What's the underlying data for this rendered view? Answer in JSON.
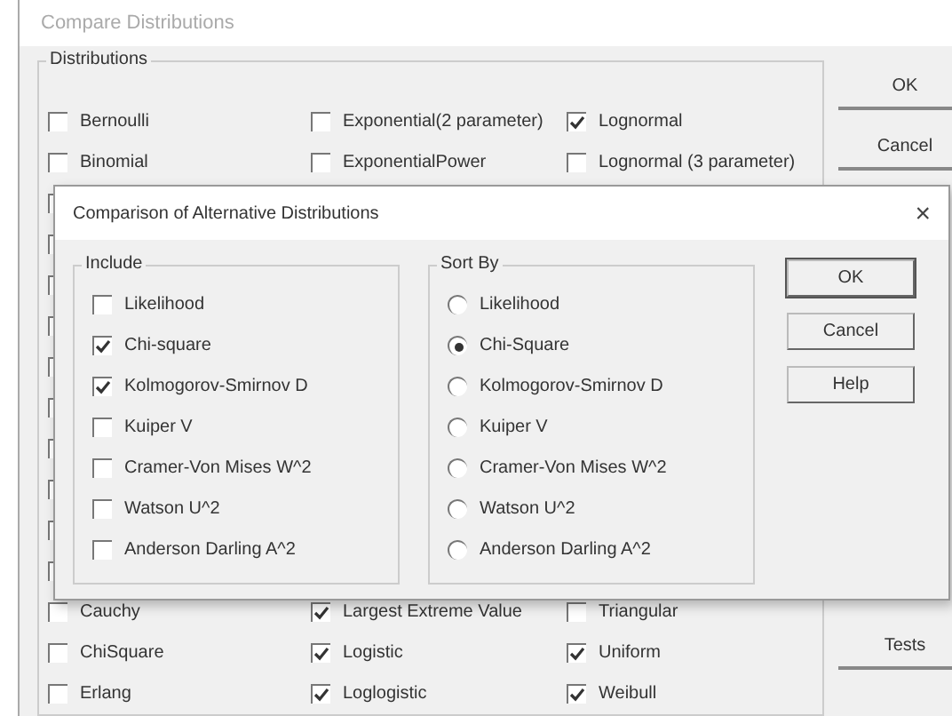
{
  "window": {
    "title": "Compare Distributions"
  },
  "distributions": {
    "title": "Distributions",
    "rows": [
      {
        "kind": "full",
        "items": [
          {
            "label": "Bernoulli",
            "checked": false
          },
          {
            "label": "Exponential(2 parameter)",
            "checked": false
          },
          {
            "label": "Lognormal",
            "checked": true
          }
        ]
      },
      {
        "kind": "full",
        "items": [
          {
            "label": "Binomial",
            "checked": false
          },
          {
            "label": "ExponentialPower",
            "checked": false
          },
          {
            "label": "Lognormal (3 parameter)",
            "checked": false
          }
        ]
      },
      {
        "kind": "covered"
      },
      {
        "kind": "covered"
      },
      {
        "kind": "covered"
      },
      {
        "kind": "covered"
      },
      {
        "kind": "covered"
      },
      {
        "kind": "covered"
      },
      {
        "kind": "covered"
      },
      {
        "kind": "covered"
      },
      {
        "kind": "covered"
      },
      {
        "kind": "covered"
      },
      {
        "kind": "full",
        "items": [
          {
            "label": "Cauchy",
            "checked": false
          },
          {
            "label": "Largest Extreme Value",
            "checked": true
          },
          {
            "label": "Triangular",
            "checked": false
          }
        ]
      },
      {
        "kind": "full",
        "items": [
          {
            "label": "ChiSquare",
            "checked": false
          },
          {
            "label": "Logistic",
            "checked": true
          },
          {
            "label": "Uniform",
            "checked": true
          }
        ]
      },
      {
        "kind": "full",
        "items": [
          {
            "label": "Erlang",
            "checked": false
          },
          {
            "label": "Loglogistic",
            "checked": true
          },
          {
            "label": "Weibull",
            "checked": true
          }
        ]
      }
    ]
  },
  "top_buttons": [
    "OK",
    "Cancel"
  ],
  "bottom_buttons": [
    "Tests"
  ],
  "dialog": {
    "title": "Comparison of Alternative Distributions",
    "close": "×",
    "include": {
      "title": "Include",
      "items": [
        {
          "label": "Likelihood",
          "checked": false
        },
        {
          "label": "Chi-square",
          "checked": true
        },
        {
          "label": "Kolmogorov-Smirnov D",
          "checked": true
        },
        {
          "label": "Kuiper V",
          "checked": false
        },
        {
          "label": "Cramer-Von Mises W^2",
          "checked": false
        },
        {
          "label": "Watson U^2",
          "checked": false
        },
        {
          "label": "Anderson Darling A^2",
          "checked": false
        }
      ]
    },
    "sort_by": {
      "title": "Sort By",
      "items": [
        {
          "label": "Likelihood",
          "selected": false
        },
        {
          "label": "Chi-Square",
          "selected": true
        },
        {
          "label": "Kolmogorov-Smirnov D",
          "selected": false
        },
        {
          "label": "Kuiper V",
          "selected": false
        },
        {
          "label": "Cramer-Von Mises W^2",
          "selected": false
        },
        {
          "label": "Watson U^2",
          "selected": false
        },
        {
          "label": "Anderson Darling A^2",
          "selected": false
        }
      ]
    },
    "buttons": [
      "OK",
      "Cancel",
      "Help"
    ]
  }
}
